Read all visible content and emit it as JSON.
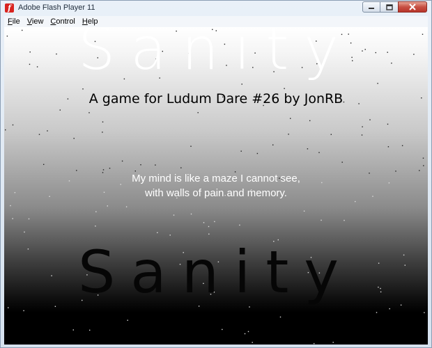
{
  "window": {
    "title": "Adobe Flash Player 11",
    "app_icon_glyph": "f"
  },
  "menu": {
    "items": [
      {
        "label": "File",
        "accel": "F",
        "rest": "ile"
      },
      {
        "label": "View",
        "accel": "V",
        "rest": "iew"
      },
      {
        "label": "Control",
        "accel": "C",
        "rest": "ontrol"
      },
      {
        "label": "Help",
        "accel": "H",
        "rest": "elp"
      }
    ]
  },
  "game": {
    "logo": "Sanity",
    "subtitle": "A game for Ludum Dare #26 by JonRB",
    "quote_line1": "My mind is like a maze I cannot see,",
    "quote_line2": "with walls of pain and memory.",
    "logo_reflection": "Sanity"
  },
  "colors": {
    "stage_top": "#ffffff",
    "stage_bottom": "#000000",
    "close_button": "#c75043"
  }
}
